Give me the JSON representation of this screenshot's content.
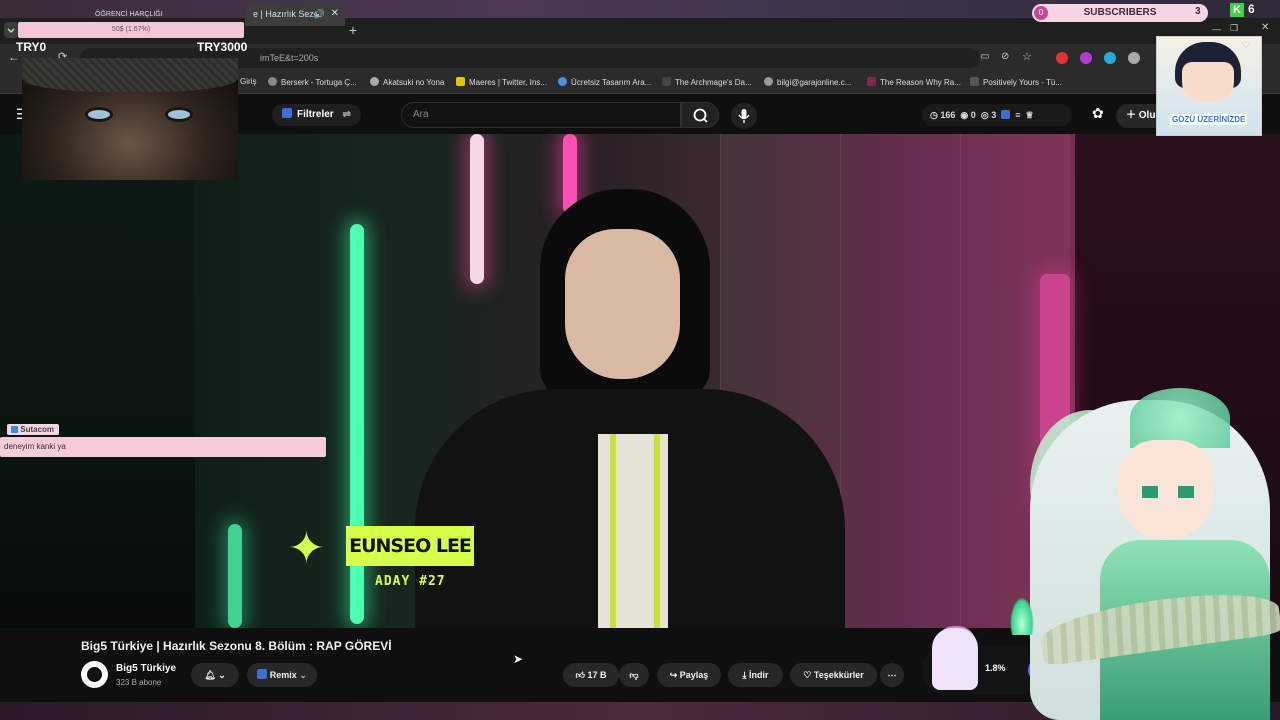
{
  "overlay": {
    "goal_label": "ÖĞRENCİ HARÇLIĞI",
    "goal_progress_text": "50$ (1.67%)",
    "goal_left": "TRY0",
    "goal_right": "TRY3000",
    "subscribers": {
      "left": "0",
      "label": "SUBSCRIBERS",
      "right": "3"
    },
    "k_badge": "K",
    "k_count": "6",
    "anime_card_text": "GÖZÜ ÜZERİNİZDE",
    "chat": {
      "user": "Sutacom",
      "message": "deneyim kanki ya"
    }
  },
  "browser": {
    "active_tab": "e | Hazırlık Sezo",
    "new_tab": "+",
    "url": "imTeE&t=200s",
    "bookmarks": [
      "Giriş",
      "Berserk - Tortuga Ç...",
      "Akatsuki no Yona",
      "Maeres | Twitter, Ins...",
      "Ücretsiz Tasarım Ara...",
      "The Archmage's Da...",
      "bilgi@garajonline.c...",
      "The Reason Why Ra...",
      "Positively Yours - Tü..."
    ]
  },
  "youtube": {
    "filter_label": "Filtreler",
    "search_placeholder": "Ara",
    "stats": {
      "a": "166",
      "b": "0",
      "c": "3"
    },
    "create_label": "Olu"
  },
  "video": {
    "name_tag": "EUNSEO LEE",
    "name_sub": "ADAY #27"
  },
  "below": {
    "title": "Big5 Türkiye | Hazırlık Sezonu 8. Bölüm : RAP GÖREVİ",
    "channel": "Big5 Türkiye",
    "subscribers": "323 B abone",
    "remix": "Remix",
    "likes": "17 B",
    "share": "Paylaş",
    "download": "İndir",
    "thanks": "Teşekkürler",
    "download_progress": "1.8%"
  },
  "colors": {
    "accent": "#d6ff4a",
    "neon_green": "#4dffb0",
    "neon_pink": "#ff4fb2",
    "chat_bg": "#f7cbd9"
  }
}
